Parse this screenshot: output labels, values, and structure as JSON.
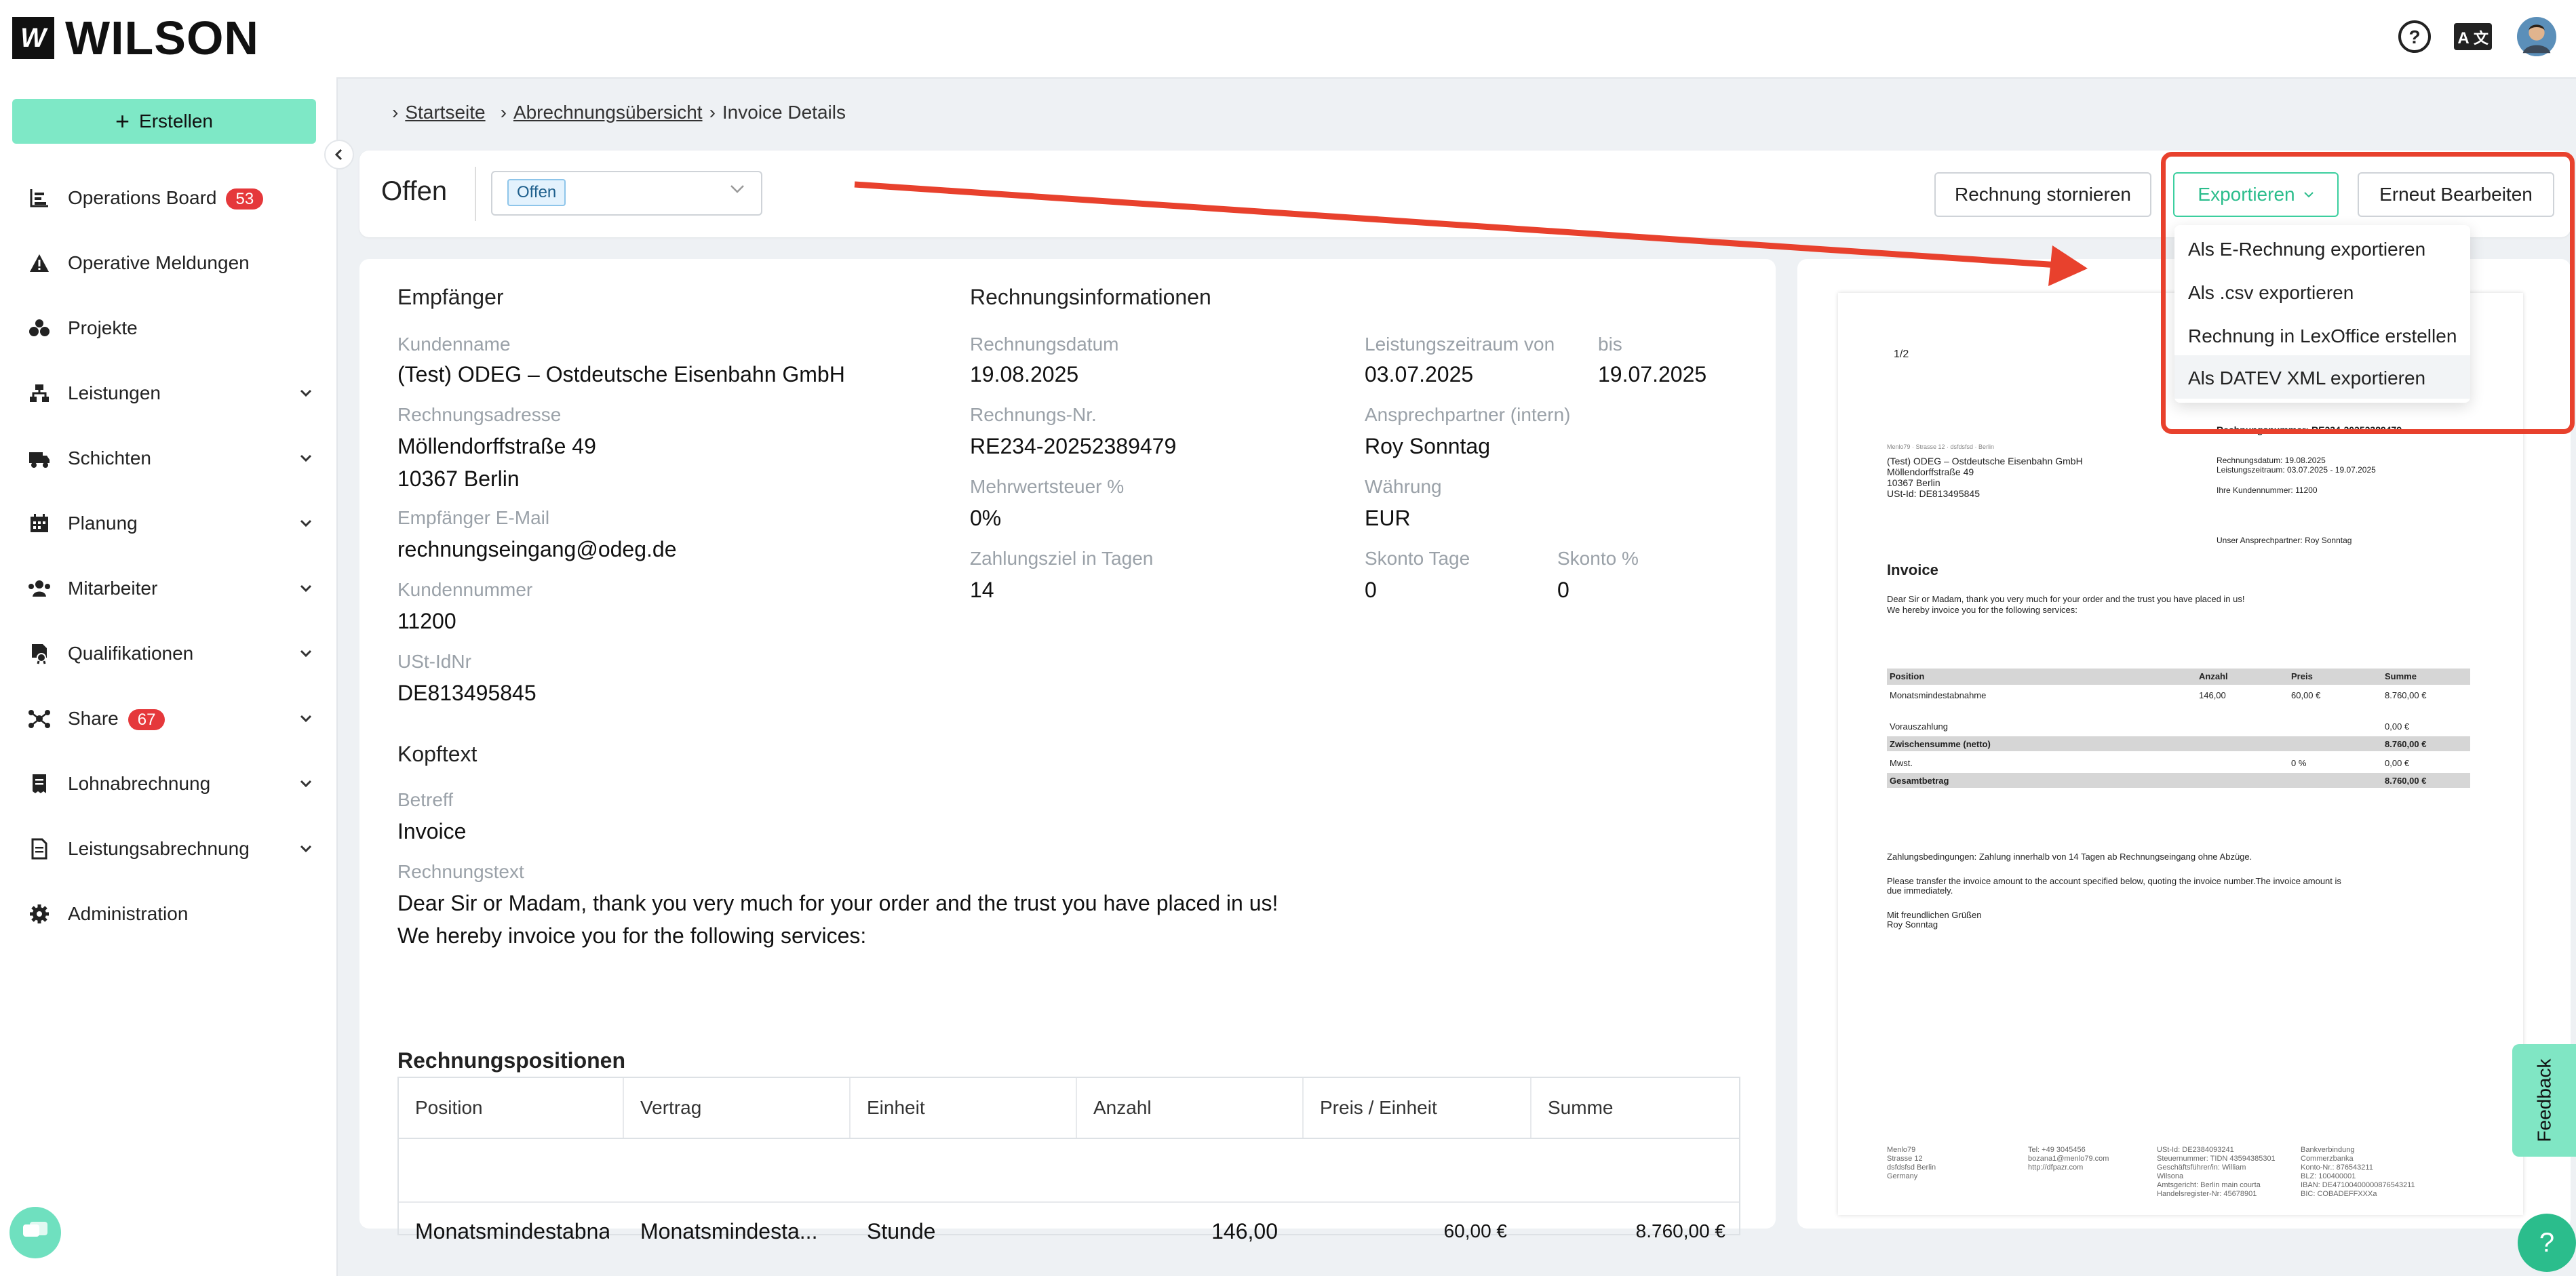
{
  "app": {
    "brand": "WILSON",
    "logo_mark": "W",
    "accent": "#7ee8c6",
    "brand_green": "#2bbd8c",
    "alert_red": "#e8412d"
  },
  "topbar": {
    "help_icon": "question-circle-icon",
    "lang_icon": "translate-icon",
    "avatar_icon": "user-avatar"
  },
  "sidebar": {
    "create_label": "Erstellen",
    "items": [
      {
        "label": "Operations Board",
        "badge": "53",
        "icon": "chart-bars-icon"
      },
      {
        "label": "Operative Meldungen",
        "icon": "warning-icon"
      },
      {
        "label": "Projekte",
        "icon": "projects-icon"
      },
      {
        "label": "Leistungen",
        "icon": "hierarchy-icon"
      },
      {
        "label": "Schichten",
        "icon": "truck-clock-icon"
      },
      {
        "label": "Planung",
        "icon": "calendar-icon"
      },
      {
        "label": "Mitarbeiter",
        "icon": "people-icon"
      },
      {
        "label": "Qualifikationen",
        "icon": "certificate-icon"
      },
      {
        "label": "Share",
        "badge": "67",
        "icon": "share-icon"
      },
      {
        "label": "Lohnabrechnung",
        "icon": "receipt-icon"
      },
      {
        "label": "Leistungsabrechnung",
        "icon": "document-icon"
      },
      {
        "label": "Administration",
        "icon": "gear-icon"
      }
    ]
  },
  "breadcrumb": {
    "home": "Startseite",
    "overview": "Abrechnungsübersicht",
    "current": "Invoice Details"
  },
  "header": {
    "status_title": "Offen",
    "status_value": "Offen",
    "cancel_label": "Rechnung stornieren",
    "export_label": "Exportieren",
    "reedit_label": "Erneut Bearbeiten"
  },
  "export_menu": [
    "Als E-Rechnung exportieren",
    "Als .csv exportieren",
    "Rechnung in LexOffice erstellen",
    "Als DATEV XML exportieren"
  ],
  "recipient": {
    "title": "Empfänger",
    "customer_name_label": "Kundenname",
    "customer_name": "(Test) ODEG – Ostdeutsche Eisenbahn GmbH",
    "address_label": "Rechnungsadresse",
    "address_line1": "Möllendorffstraße 49",
    "address_line2": "10367 Berlin",
    "email_label": "Empfänger E-Mail",
    "email": "rechnungseingang@odeg.de",
    "customer_no_label": "Kundennummer",
    "customer_no": "11200",
    "vat_label": "USt-IdNr",
    "vat": "DE813495845"
  },
  "invoice_info": {
    "title": "Rechnungsinformationen",
    "date_label": "Rechnungsdatum",
    "date": "19.08.2025",
    "period_label": "Leistungszeitraum von",
    "period_from": "03.07.2025",
    "until_label": "bis",
    "period_to": "19.07.2025",
    "number_label": "Rechnungs-Nr.",
    "number": "RE234-20252389479",
    "contact_label": "Ansprechpartner (intern)",
    "contact": "Roy Sonntag",
    "vat_pct_label": "Mehrwertsteuer %",
    "vat_pct": "0%",
    "currency_label": "Währung",
    "currency": "EUR",
    "due_label": "Zahlungsziel in Tagen",
    "due": "14",
    "skonto_days_label": "Skonto Tage",
    "skonto_days": "0",
    "skonto_pct_label": "Skonto %",
    "skonto_pct": "0"
  },
  "header_text": {
    "title": "Kopftext",
    "subject_label": "Betreff",
    "subject": "Invoice",
    "text_label": "Rechnungstext",
    "text_line1": "Dear Sir or Madam, thank you very much for your order and the trust you have placed in us!",
    "text_line2": "We hereby invoice you for the following services:"
  },
  "positions": {
    "title": "Rechnungspositionen",
    "columns": [
      "Position",
      "Vertrag",
      "Einheit",
      "Anzahl",
      "Preis / Einheit",
      "Summe"
    ],
    "rows": [
      {
        "position": "Monatsmindestabnahme",
        "contract": "Monatsmindesta...",
        "unit": "Stunde",
        "qty": "146,00",
        "price": "60,00 €",
        "sum": "8.760,00 €"
      }
    ]
  },
  "preview": {
    "page": "1/2",
    "sender_line": "Menlo79 · Strasse 12 · dsfdsfsd · Berlin",
    "recipient_lines": [
      "(Test) ODEG – Ostdeutsche Eisenbahn GmbH",
      "Möllendorffstraße 49",
      "10367 Berlin",
      "USt-Id: DE813495845"
    ],
    "number_line": "Rechnungsnummer: RE234-20252389479",
    "info_lines": [
      "Rechnungsdatum: 19.08.2025",
      "Leistungszeitraum: 03.07.2025 - 19.07.2025",
      "Ihre Kundennummer: 11200"
    ],
    "contact_line": "Unser Ansprechpartner: Roy Sonntag",
    "heading": "Invoice",
    "intro_lines": [
      "Dear Sir or Madam, thank you very much for your order and the trust you have placed in us!",
      "We hereby invoice you for the following services:"
    ],
    "table_head": [
      "Position",
      "Anzahl",
      "Preis",
      "Summe"
    ],
    "table_row": [
      "Monatsmindestabnahme",
      "146,00",
      "60,00 €",
      "8.760,00 €"
    ],
    "summary": [
      {
        "label": "Vorauszahlung",
        "mid": "",
        "value": "0,00 €",
        "shade": false
      },
      {
        "label": "Zwischensumme (netto)",
        "mid": "",
        "value": "8.760,00 €",
        "shade": true
      },
      {
        "label": "Mwst.",
        "mid": "0 %",
        "value": "0,00 €",
        "shade": false
      },
      {
        "label": "Gesamtbetrag",
        "mid": "",
        "value": "8.760,00 €",
        "shade": true
      }
    ],
    "terms_line": "Zahlungsbedingungen: Zahlung innerhalb von 14 Tagen ab Rechnungseingang ohne Abzüge.",
    "transfer_lines": [
      "Please transfer the invoice amount to the account specified below, quoting the invoice number.The invoice amount is",
      "due immediately."
    ],
    "closing_lines": [
      "Mit freundlichen Grüßen",
      "Roy Sonntag"
    ],
    "footer_cols": [
      [
        "Menlo79",
        "Strasse 12",
        "dsfdsfsd Berlin",
        "Germany"
      ],
      [
        "Tel: +49 3045456",
        "bozana1@menlo79.com",
        "http://dfpazr.com"
      ],
      [
        "USt-Id: DE2384093241",
        "Steuernummer: TIDN 43594385301",
        "Geschäftsführer/in: William",
        "Wilsona",
        "Amtsgericht: Berlin main courta",
        "Handelsregister-Nr: 45678901"
      ],
      [
        "Bankverbindung",
        "Commerzbanka",
        "Konto-Nr.: 876543211",
        "BLZ: 100400001",
        "IBAN: DE47100400000876543211",
        "BIC: COBADEFFXXXa"
      ]
    ]
  },
  "feedback_label": "Feedback",
  "help_fab_label": "?"
}
